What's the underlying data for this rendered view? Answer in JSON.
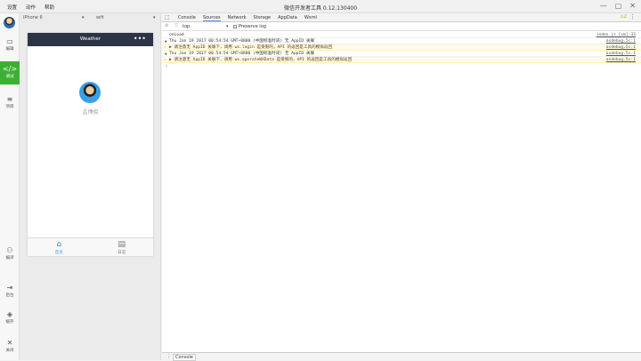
{
  "titlebar": {
    "menu": [
      "设置",
      "动作",
      "帮助"
    ],
    "title": "微信开发者工具 0.12.130400",
    "window_controls": [
      "—",
      "▢",
      "✕"
    ]
  },
  "sidebar": {
    "items": [
      {
        "label": "编辑",
        "icon": "monitor-icon",
        "glyph": "▭",
        "active": false
      },
      {
        "label": "调试",
        "icon": "code-icon",
        "glyph": "</>",
        "active": true
      },
      {
        "label": "项目",
        "icon": "list-icon",
        "glyph": "≡",
        "active": false
      },
      {
        "label": "编译",
        "icon": "compile-icon",
        "glyph": "⚇",
        "active": false
      },
      {
        "label": "后台",
        "icon": "backend-icon",
        "glyph": "⇥",
        "active": false
      },
      {
        "label": "缓存",
        "icon": "layers-icon",
        "glyph": "◈",
        "active": false
      },
      {
        "label": "关闭",
        "icon": "close-icon",
        "glyph": "✕",
        "active": false
      }
    ]
  },
  "simulator": {
    "device": "iPhone 6",
    "network": "wifi",
    "nav_title": "Weather",
    "nav_menu": "•••",
    "username": "孟博俊",
    "tabs": [
      {
        "label": "首页",
        "icon": "home-icon",
        "glyph": "⌂",
        "active": true
      },
      {
        "label": "日志",
        "icon": "log-icon",
        "glyph": "▤",
        "active": false
      }
    ]
  },
  "devtools": {
    "tabs": [
      "Console",
      "Sources",
      "Network",
      "Storage",
      "AppData",
      "Wxml"
    ],
    "active_tab": "Sources",
    "warning_count": "⚠2",
    "filter": {
      "context": "top",
      "preserve_log": "Preserve log"
    },
    "console_lines": [
      {
        "kind": "log",
        "text": "onLoad",
        "source": "index.js [sm]:33"
      },
      {
        "kind": "group",
        "text": "Thu Jan 19 2017 00:54:54 GMT+0800 (中国标准时间) 无 AppID 关联",
        "source": "asdebug.5c:1"
      },
      {
        "kind": "warn",
        "text": "▶ 请注意无 AppID 关联下，调用 wx.login 是受限的，API 的返回是工具的模拟返回",
        "source": "asdebug.5c:1"
      },
      {
        "kind": "group",
        "text": "Thu Jan 19 2017 00:54:54 GMT+0800 (中国标准时间) 无 AppID 关联",
        "source": "asdebug.5c:1"
      },
      {
        "kind": "warn",
        "text": "▶ 请注意无 AppID 关联下，调用 wx.operateWXData 是受限的，API 的返回是工具的模拟返回",
        "source": "asdebug.5c:1"
      }
    ],
    "prompt": "›",
    "drawer_tab": "Console"
  },
  "colors": {
    "accent_green": "#3cb034",
    "nav_dark": "#2c3545",
    "link_blue": "#3a8ee6",
    "warn_bg": "#fffbe5"
  }
}
